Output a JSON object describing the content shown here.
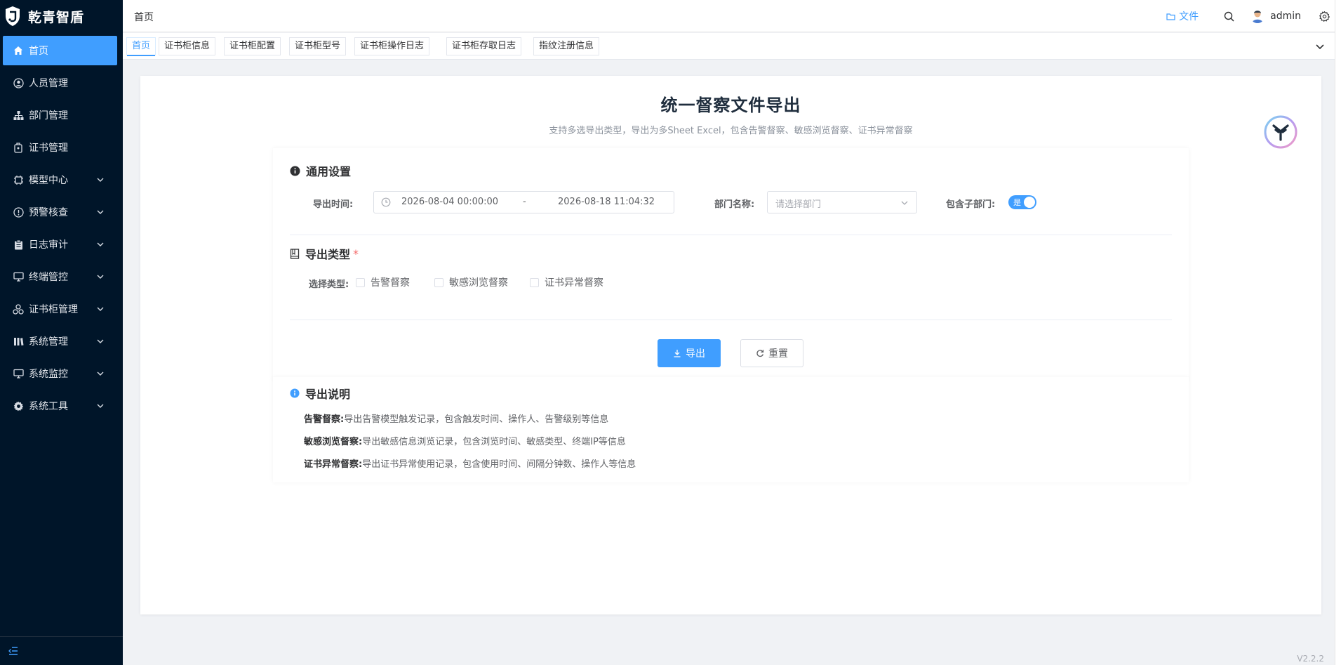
{
  "app": {
    "name": "乾青智盾",
    "version": "V2.2.2"
  },
  "sidebar": {
    "items": [
      {
        "label": "首页",
        "icon": "home-icon",
        "active": true,
        "expandable": false
      },
      {
        "label": "人员管理",
        "icon": "user-circle-icon",
        "active": false,
        "expandable": false
      },
      {
        "label": "部门管理",
        "icon": "org-tree-icon",
        "active": false,
        "expandable": false
      },
      {
        "label": "证书管理",
        "icon": "certificate-icon",
        "active": false,
        "expandable": false
      },
      {
        "label": "模型中心",
        "icon": "model-icon",
        "active": false,
        "expandable": true
      },
      {
        "label": "预警核查",
        "icon": "warning-circle-icon",
        "active": false,
        "expandable": true
      },
      {
        "label": "日志审计",
        "icon": "clipboard-icon",
        "active": false,
        "expandable": true
      },
      {
        "label": "终端管控",
        "icon": "monitor-icon",
        "active": false,
        "expandable": true
      },
      {
        "label": "证书柜管理",
        "icon": "cabinet-icon",
        "active": false,
        "expandable": true
      },
      {
        "label": "系统管理",
        "icon": "system-icon",
        "active": false,
        "expandable": true
      },
      {
        "label": "系统监控",
        "icon": "monitor-icon",
        "active": false,
        "expandable": true
      },
      {
        "label": "系统工具",
        "icon": "gear-icon",
        "active": false,
        "expandable": true
      }
    ]
  },
  "header": {
    "breadcrumb": "首页",
    "file_label": "文件",
    "username": "admin"
  },
  "tabs": [
    {
      "label": "首页",
      "active": true
    },
    {
      "label": "证书柜信息",
      "active": false
    },
    {
      "label": "证书柜配置",
      "active": false
    },
    {
      "label": "证书柜型号",
      "active": false
    },
    {
      "label": "证书柜操作日志",
      "active": false
    },
    {
      "label": "证书柜存取日志",
      "active": false
    },
    {
      "label": "指纹注册信息",
      "active": false
    }
  ],
  "main": {
    "title": "统一督察文件导出",
    "subtitle": "支持多选导出类型，导出为多Sheet Excel，包含告警督察、敏感浏览督察、证书异常督察",
    "general": {
      "title": "通用设置",
      "time_label": "导出时间:",
      "start_date": "2026-08-04 00:00:00",
      "range_separator": "-",
      "end_date": "2026-08-18 11:04:32",
      "dept_label": "部门名称:",
      "dept_placeholder": "请选择部门",
      "sub_dept_label": "包含子部门:",
      "sub_dept_switch_text": "是",
      "sub_dept_on": true
    },
    "export_type": {
      "title": "导出类型",
      "required_mark": "*",
      "select_label": "选择类型:",
      "options": [
        {
          "label": "告警督察",
          "checked": false
        },
        {
          "label": "敏感浏览督察",
          "checked": false
        },
        {
          "label": "证书异常督察",
          "checked": false
        }
      ]
    },
    "buttons": {
      "export": "导出",
      "reset": "重置"
    },
    "notes": {
      "title": "导出说明",
      "items": [
        {
          "term": "告警督察:",
          "desc": "导出告警模型触发记录，包含触发时间、操作人、告警级别等信息"
        },
        {
          "term": "敏感浏览督察:",
          "desc": "导出敏感信息浏览记录，包含浏览时间、敏感类型、终端IP等信息"
        },
        {
          "term": "证书异常督察:",
          "desc": "导出证书异常使用记录，包含使用时间、间隔分钟数、操作人等信息"
        }
      ]
    }
  },
  "colors": {
    "sidebar_bg": "#001529",
    "accent": "#409eff",
    "page_bg": "#f0f2f5"
  }
}
